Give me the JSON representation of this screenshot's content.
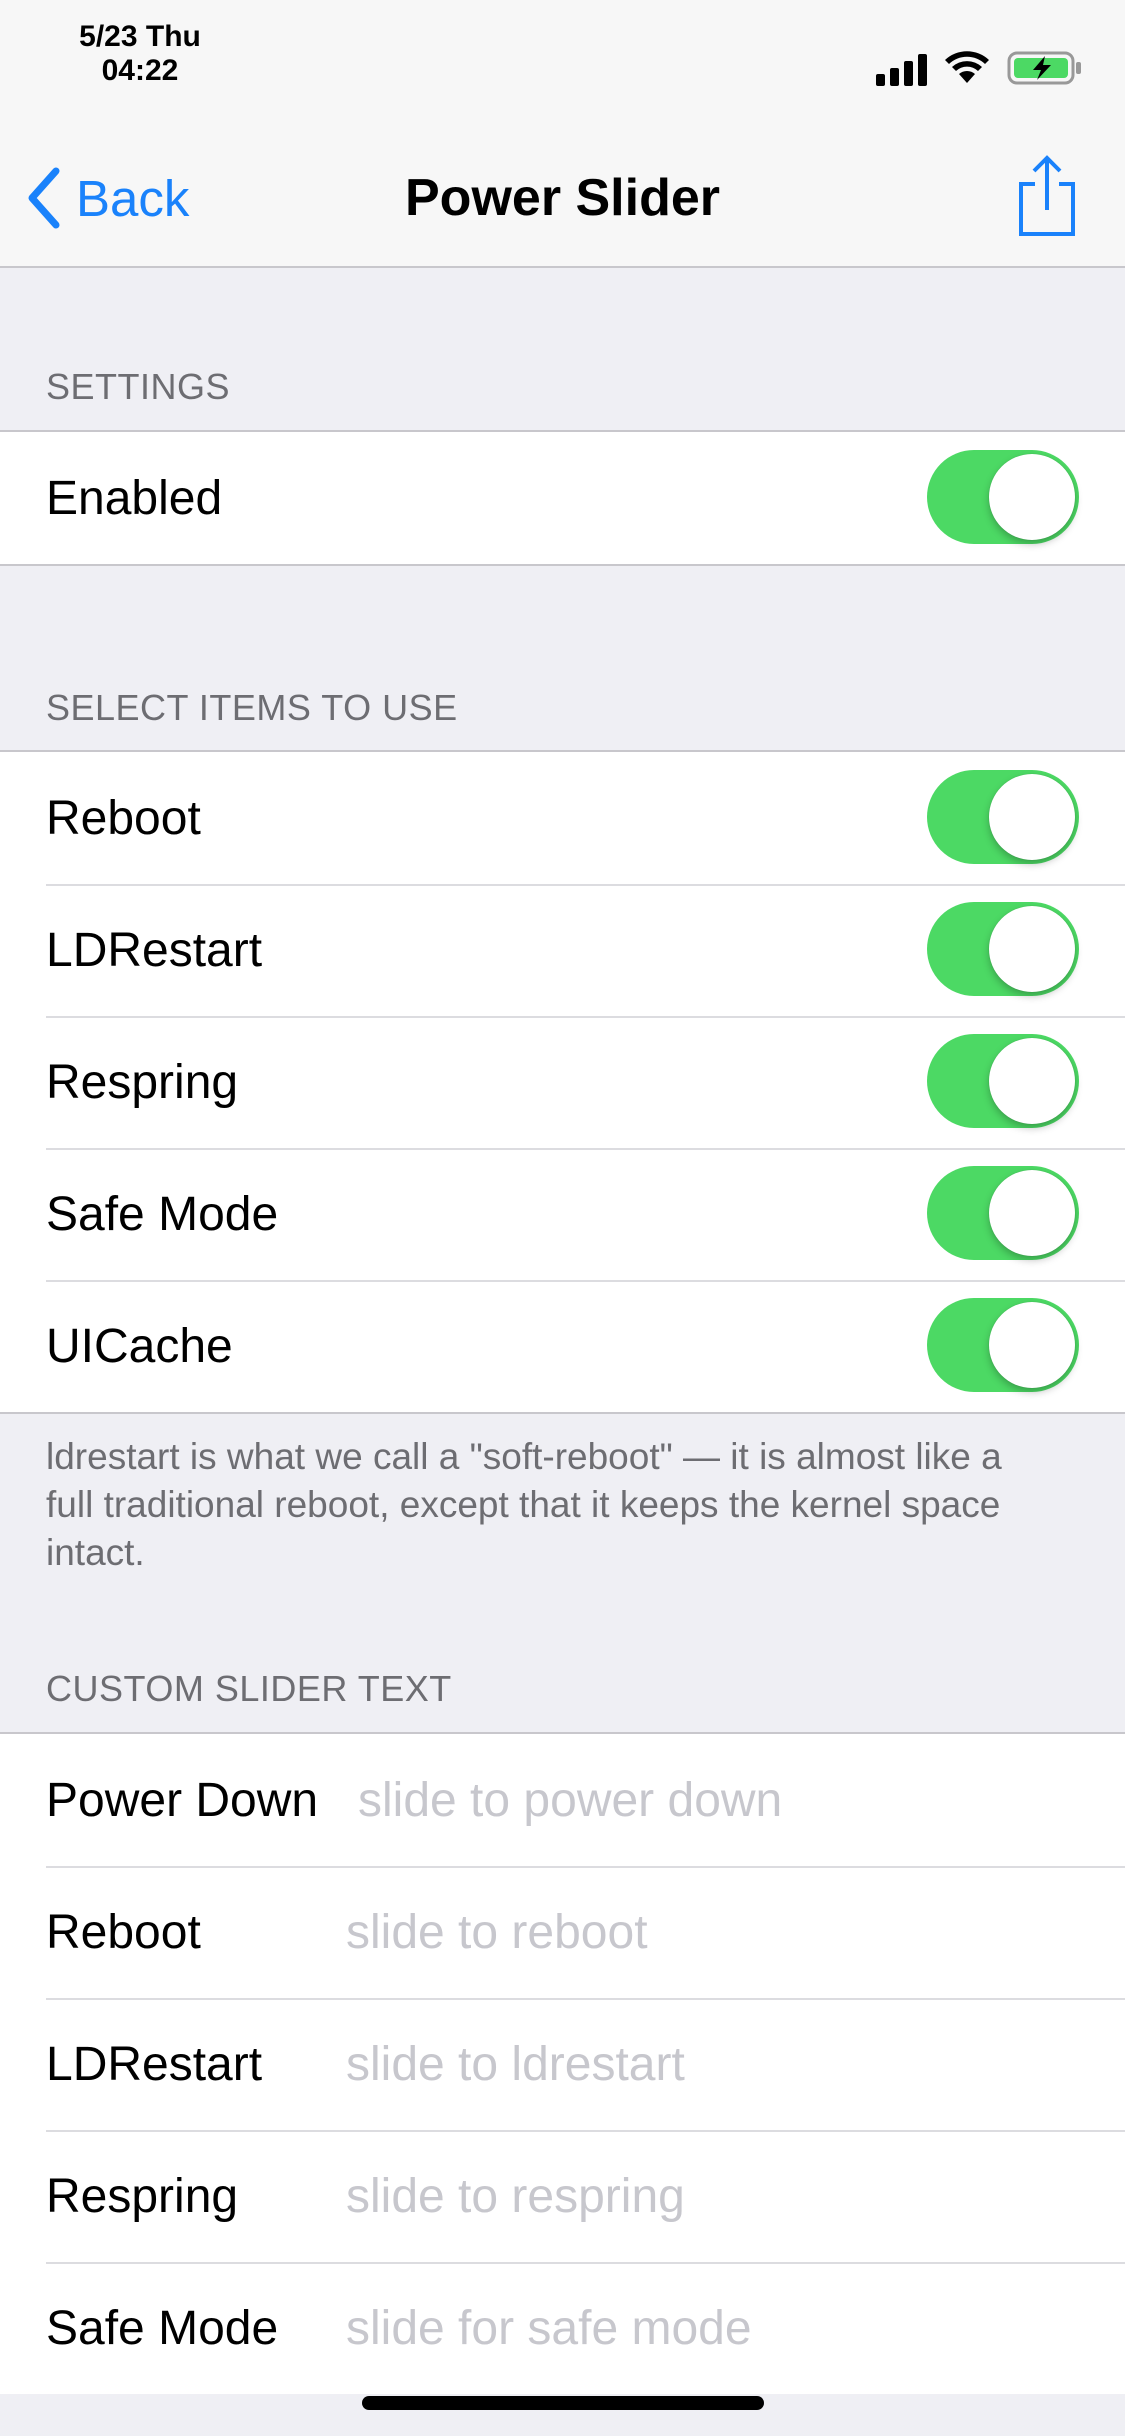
{
  "status_bar": {
    "date": "5/23 Thu",
    "time": "04:22"
  },
  "nav": {
    "back_label": "Back",
    "title": "Power Slider"
  },
  "settings": {
    "header": "SETTINGS",
    "rows": [
      {
        "label": "Enabled",
        "on": true
      }
    ]
  },
  "items": {
    "header": "SELECT ITEMS TO USE",
    "rows": [
      {
        "label": "Reboot",
        "on": true
      },
      {
        "label": "LDRestart",
        "on": true
      },
      {
        "label": "Respring",
        "on": true
      },
      {
        "label": "Safe Mode",
        "on": true
      },
      {
        "label": "UICache",
        "on": true
      }
    ],
    "footer": "ldrestart is what we call a \"soft-reboot\" — it is almost like a full traditional reboot, except that it keeps the kernel space intact."
  },
  "slider_text": {
    "header": "CUSTOM SLIDER TEXT",
    "rows": [
      {
        "label": "Power Down",
        "value": "",
        "placeholder": "slide to power down"
      },
      {
        "label": "Reboot",
        "value": "",
        "placeholder": "slide to reboot"
      },
      {
        "label": "LDRestart",
        "value": "",
        "placeholder": "slide to ldrestart"
      },
      {
        "label": "Respring",
        "value": "",
        "placeholder": "slide to respring"
      },
      {
        "label": "Safe Mode",
        "value": "",
        "placeholder": "slide for safe mode"
      }
    ]
  },
  "colors": {
    "accent": "#1a82fb",
    "toggle_on": "#4cd964",
    "battery": "#4cd964"
  },
  "icons": [
    "signal-icon",
    "wifi-icon",
    "battery-charging-icon",
    "chevron-left-icon",
    "share-icon"
  ]
}
